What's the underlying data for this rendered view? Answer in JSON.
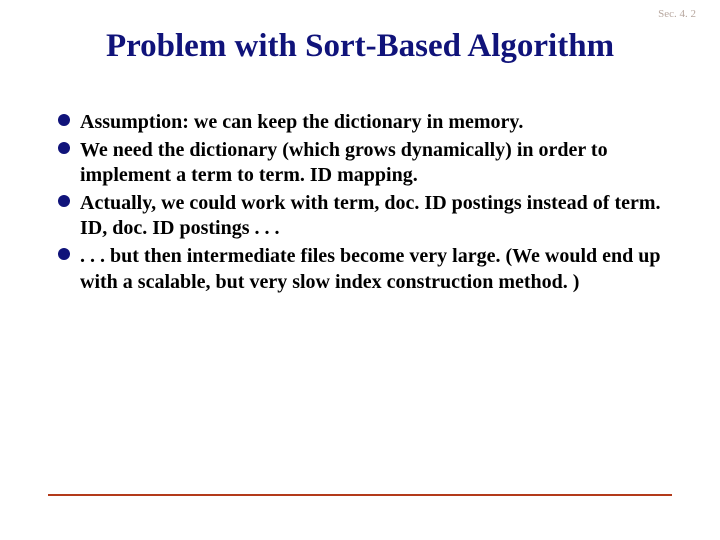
{
  "slide": {
    "section_label": "Sec. 4. 2",
    "title": "Problem with Sort-Based Algorithm",
    "bullets": [
      "Assumption: we can keep the dictionary in memory.",
      "We need the dictionary (which grows dynamically) in order to implement a term to term. ID mapping.",
      "Actually, we could work with term, doc. ID postings instead of term. ID, doc. ID postings . . .",
      ". . . but then intermediate files become very large. (We would end up with a scalable, but very slow index construction method. )"
    ]
  },
  "colors": {
    "title_color": "#10137a",
    "bullet_dot": "#10137a",
    "footer_line": "#b33a1a",
    "section_label": "#b8a8a0"
  }
}
